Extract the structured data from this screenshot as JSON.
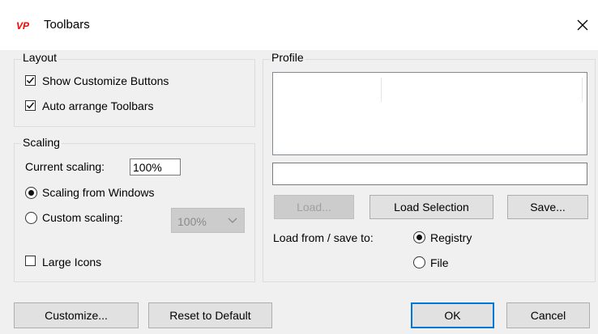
{
  "window": {
    "title": "Toolbars",
    "icon_text": "VP"
  },
  "layout_group": {
    "label": "Layout",
    "show_customize_buttons": {
      "label": "Show Customize Buttons",
      "checked": true
    },
    "auto_arrange": {
      "label": "Auto arrange Toolbars",
      "checked": true
    }
  },
  "scaling_group": {
    "label": "Scaling",
    "current_scaling_label": "Current scaling:",
    "current_scaling_value": "100%",
    "from_windows": {
      "label": "Scaling from Windows",
      "selected": true
    },
    "custom": {
      "label": "Custom scaling:",
      "selected": false
    },
    "custom_value": "100%",
    "large_icons": {
      "label": "Large Icons",
      "checked": false
    }
  },
  "profile_group": {
    "label": "Profile",
    "name_value": "",
    "load_label": "Load...",
    "load_selection_label": "Load Selection",
    "save_label": "Save...",
    "load_from_label": "Load from / save to:",
    "registry": {
      "label": "Registry",
      "selected": true
    },
    "file": {
      "label": "File",
      "selected": false
    }
  },
  "footer": {
    "customize_label": "Customize...",
    "reset_label": "Reset to Default",
    "ok_label": "OK",
    "cancel_label": "Cancel"
  }
}
